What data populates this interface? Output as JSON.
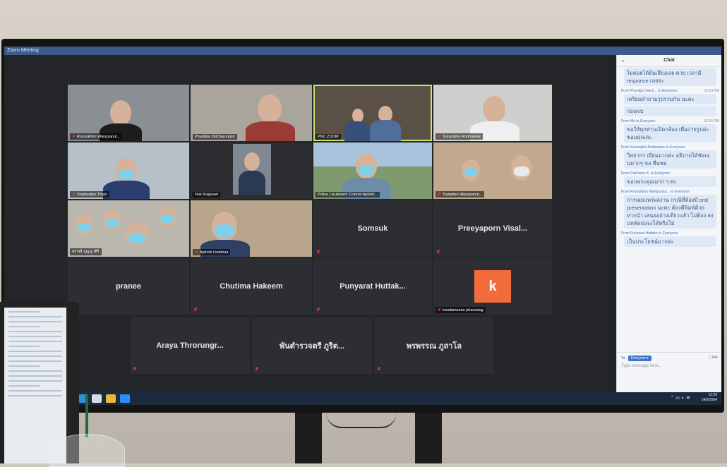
{
  "window_title": "Zoom Meeting",
  "chat": {
    "header": "Chat",
    "messages": [
      {
        "from": "",
        "time": "",
        "text": "ไม่ค่อยได้ยินเสียงเลย ดาย เวลามี response เลยจะ"
      },
      {
        "from": "From Phantipa Vatch... to Everyone:",
        "time": "12:14 PM",
        "text": "เตรียมคำถามรูปรวมกัน นะคะ"
      },
      {
        "from": "",
        "time": "",
        "text": "ก่อนจบ"
      },
      {
        "from": "From Me to Everyone:",
        "time": "12:15 PM",
        "text": "ขอให้ทุกท่านเปิดกล้อง เพื่อถ่ายรูปค่ะ ขอบคุณค่ะ"
      },
      {
        "from": "From Surampha Rodmanee to Everyone:",
        "time": "",
        "text": "วิทยากร เยี่ยมมากค่ะ อธิบายได้ชัดเจนมากๆ ขอ ขื่นชม"
      },
      {
        "from": "From Pakharee K. to Everyone:",
        "time": "",
        "text": "ขอบพระคุณมาก ๆ ค่ะ"
      },
      {
        "from": "From Rossukhon Wangsanut... to Everyone:",
        "time": "",
        "text": "การเผยแพร่ผลงาน กรณีที่ต้องมี oral presentation นะคะ ต้องตีพิมพ์ด้วย หากนำ เสนออย่างเดียวแล้ว ไม่ต้อง ลงบทคัดย่อจะได้หรือไม่"
      },
      {
        "from": "From Punyarat Huttako to Everyone:",
        "time": "",
        "text": "เป็นประโยชน์มากค่ะ"
      }
    ],
    "to_label": "To:",
    "to_value": "Everyone",
    "file_label": "File",
    "type_placeholder": "Type message here..."
  },
  "tiles": [
    {
      "name": "Rossukhon Wangsanut...",
      "kind": "video"
    },
    {
      "name": "Phantipa Vatcharungsri",
      "kind": "video"
    },
    {
      "name": "PNC ZOOM",
      "kind": "video"
    },
    {
      "name": "Surampha Rodmanee",
      "kind": "video"
    },
    {
      "name": "Sopitsudee Thuts",
      "kind": "video"
    },
    {
      "name": "Nok Rojjanart",
      "kind": "video"
    },
    {
      "name": "Police Lieutenant Colonel Aphisit...",
      "kind": "video"
    },
    {
      "name": "Yuwadee Wangsanut...",
      "kind": "video"
    },
    {
      "name": "พรรณี บุญญาศิริ",
      "kind": "video"
    },
    {
      "name": "Apirom Lienbrua",
      "kind": "video"
    },
    {
      "name": "Somsuk",
      "kind": "name"
    },
    {
      "name": "Preeyaporn Visal...",
      "kind": "name"
    },
    {
      "name": "pranee",
      "kind": "name"
    },
    {
      "name": "Chutima Hakeem",
      "kind": "name"
    },
    {
      "name": "Punyarat Huttak...",
      "kind": "name"
    },
    {
      "name": "kandamanee phansang",
      "kind": "avatar",
      "initial": "k"
    },
    {
      "name": "Araya Throrungr...",
      "kind": "name"
    },
    {
      "name": "พันตำรวจตรี ภูริต...",
      "kind": "name"
    },
    {
      "name": "พรพรรณ ภูสาโล",
      "kind": "name"
    }
  ],
  "taskbar": {
    "time": "12:20",
    "date": "14/9/2564"
  },
  "colors": {
    "accent": "#3e73c8",
    "muted_mic": "#e0463f",
    "avatar_bg": "#f26b3a",
    "active_speaker": "#c8e36a"
  }
}
